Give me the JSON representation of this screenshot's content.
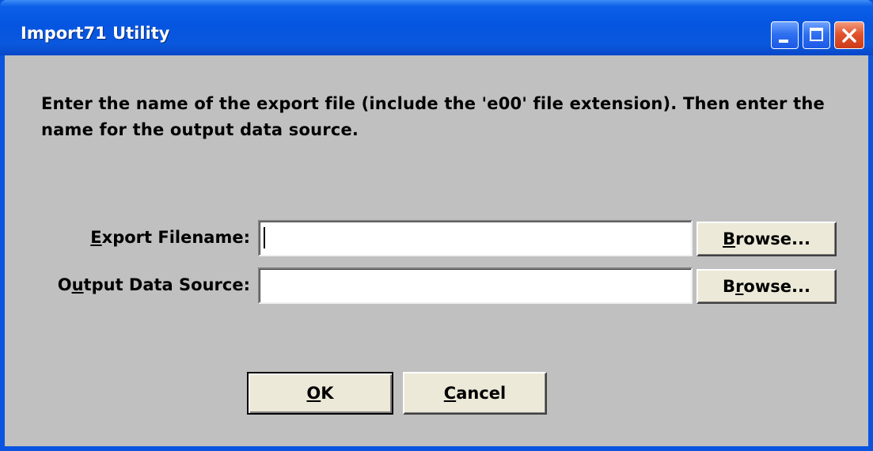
{
  "window": {
    "title": "Import71 Utility",
    "colors": {
      "titlebar": "#0555e0",
      "client_bg": "#c0c0c0",
      "close_button": "#e2542d"
    }
  },
  "titlebar_buttons": {
    "minimize_icon": "minimize-icon",
    "maximize_icon": "maximize-icon",
    "close_icon": "close-icon"
  },
  "instructions": "Enter the name of the export file (include the 'e00' file extension). Then enter the name for the output data source.",
  "fields": {
    "export_filename": {
      "label_access_key": "E",
      "label_rest": "xport Filename:",
      "value": ""
    },
    "output_data_source": {
      "label_before": "O",
      "label_access_key": "u",
      "label_rest": "tput Data Source:",
      "value": ""
    }
  },
  "browse_buttons": [
    {
      "label_before": "",
      "access_key": "B",
      "label_rest": "rowse..."
    },
    {
      "label_before": "B",
      "access_key": "r",
      "label_rest": "owse..."
    }
  ],
  "actions": {
    "ok": {
      "access_key": "O",
      "label_rest": "K"
    },
    "cancel": {
      "access_key": "C",
      "label_rest": "ancel"
    }
  }
}
